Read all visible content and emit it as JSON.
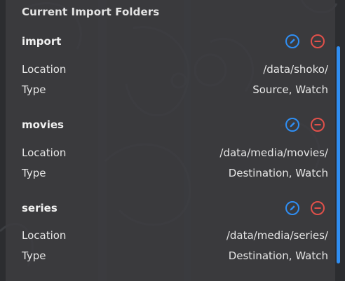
{
  "panel": {
    "title": "Current Import Folders",
    "folders": [
      {
        "name": "import",
        "location_label": "Location",
        "location": "/data/shoko/",
        "type_label": "Type",
        "type": "Source, Watch"
      },
      {
        "name": "movies",
        "location_label": "Location",
        "location": "/data/media/movies/",
        "type_label": "Type",
        "type": "Destination, Watch"
      },
      {
        "name": "series",
        "location_label": "Location",
        "location": "/data/media/series/",
        "type_label": "Type",
        "type": "Destination, Watch"
      }
    ]
  },
  "icons": {
    "edit": "edit-pencil-icon",
    "remove": "remove-minus-icon"
  },
  "colors": {
    "accent": "#2f8ef3",
    "danger": "#e0504a",
    "panel": "#3c3d40"
  }
}
